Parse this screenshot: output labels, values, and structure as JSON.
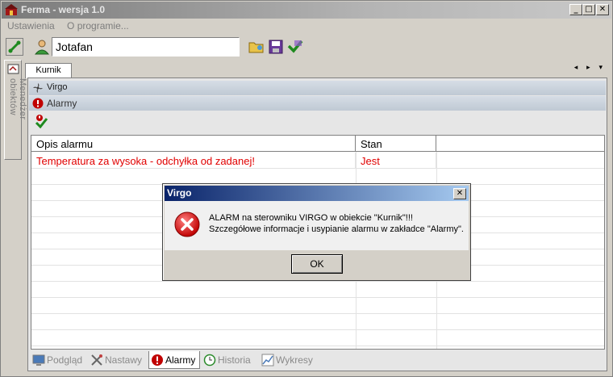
{
  "window": {
    "title": "Ferma - wersja 1.0",
    "min_label": "_",
    "max_label": "□",
    "close_label": "✕"
  },
  "menu": {
    "items": [
      "Ustawienia",
      "O programie..."
    ]
  },
  "toolbar": {
    "user_value": "Jotafan"
  },
  "sidebar": {
    "tab_label": "Menedżer obiektów"
  },
  "tabs": {
    "main": "Kurnik",
    "nav": "◂ ▸ ▾"
  },
  "panel": {
    "controller_label": "Virgo",
    "section_label": "Alarmy"
  },
  "grid": {
    "columns": [
      "Opis alarmu",
      "Stan"
    ],
    "rows": [
      {
        "opis": "Temperatura za wysoka - odchyłka od zadanej!",
        "stan": "Jest"
      }
    ]
  },
  "bottom_tabs": [
    "Podgląd",
    "Nastawy",
    "Alarmy",
    "Historia",
    "Wykresy"
  ],
  "dialog": {
    "title": "Virgo",
    "close_label": "✕",
    "line1": "ALARM na sterowniku VIRGO w obiekcie \"Kurnik\"!!!",
    "line2": "Szczegółowe informacje i usypianie alarmu w zakładce \"Alarmy\".",
    "ok_label": "OK"
  },
  "colors": {
    "alarm_text": "#e10000",
    "dialog_title_bar": "#0a246a"
  }
}
